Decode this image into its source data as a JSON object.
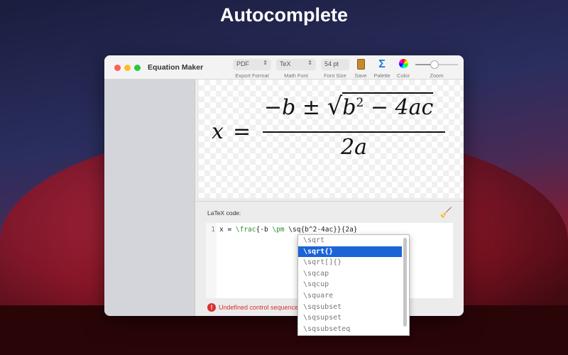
{
  "headline": "Autocomplete",
  "window": {
    "title": "Equation Maker"
  },
  "toolbar": {
    "export_format": {
      "value": "PDF",
      "label": "Export Format"
    },
    "math_font": {
      "value": "TeX",
      "label": "Math Font"
    },
    "font_size": {
      "value": "54 pt",
      "label": "Font Size"
    },
    "save": {
      "label": "Save"
    },
    "palette": {
      "label": "Palette"
    },
    "color": {
      "label": "Color"
    },
    "zoom": {
      "label": "Zoom",
      "value": 0.45
    }
  },
  "preview": {
    "lhs": "x",
    "eq": "=",
    "num": "−b ± ",
    "rad": "b",
    "sup": "2",
    "rad_rest": " − 4ac",
    "den": "2a"
  },
  "editor": {
    "label": "LaTeX code:",
    "line_number": "1",
    "code": [
      {
        "t": "x = ",
        "k": false
      },
      {
        "t": "\\frac",
        "k": true
      },
      {
        "t": "{-b ",
        "k": false
      },
      {
        "t": "\\pm",
        "k": true
      },
      {
        "t": " \\sq{b^2-4ac}}{2a}",
        "k": false
      }
    ],
    "error": "Undefined control sequence"
  },
  "autocomplete": {
    "items": [
      "\\sqrt",
      "\\sqrt{}",
      "\\sqrt[]{}",
      "\\sqcap",
      "\\sqcup",
      "\\square",
      "\\sqsubset",
      "\\sqsupset",
      "\\sqsubseteq"
    ],
    "selected": 1
  }
}
